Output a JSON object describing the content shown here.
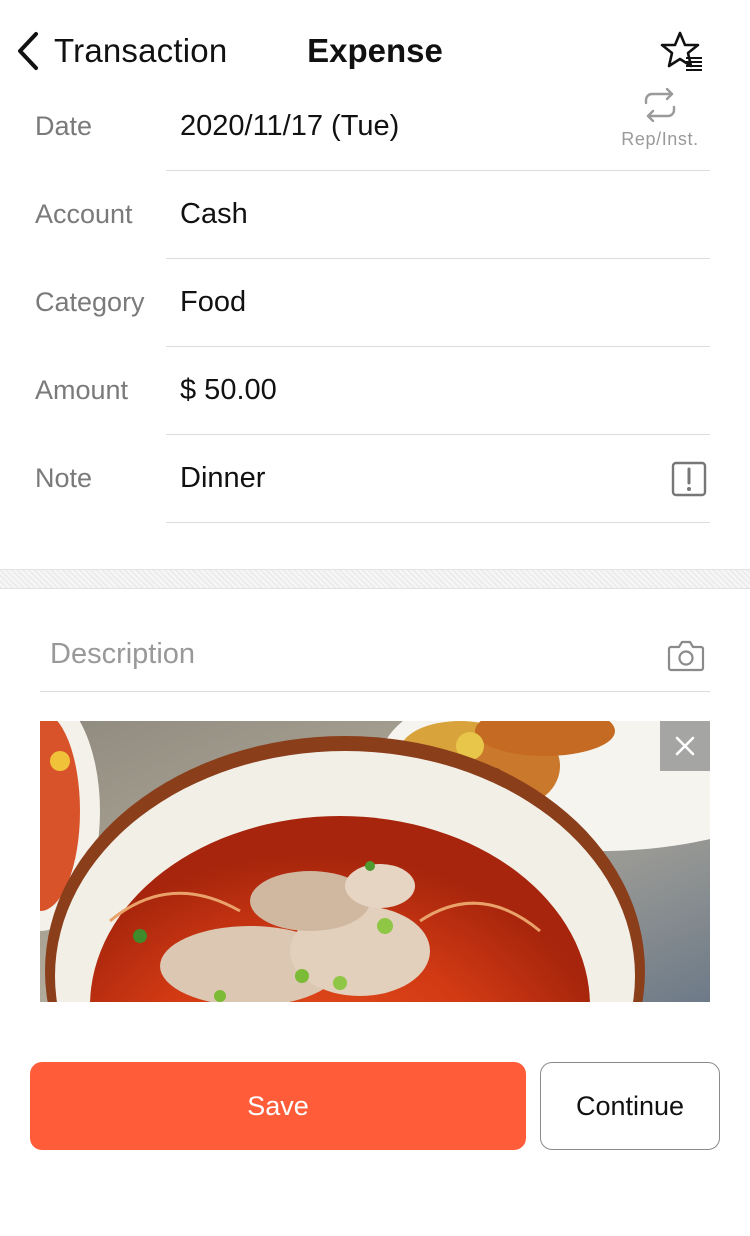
{
  "header": {
    "back_label": "Transaction",
    "title": "Expense",
    "icons": {
      "back": "chevron-left-icon",
      "favorite": "star-list-icon"
    }
  },
  "form": {
    "rows": [
      {
        "label": "Date",
        "value": "2020/11/17 (Tue)"
      },
      {
        "label": "Account",
        "value": "Cash"
      },
      {
        "label": "Category",
        "value": "Food"
      },
      {
        "label": "Amount",
        "value": "$ 50.00"
      },
      {
        "label": "Note",
        "value": "Dinner"
      }
    ],
    "repeat_caption": "Rep/Inst.",
    "icons": {
      "repeat": "repeat-icon",
      "note": "alert-square-icon"
    }
  },
  "description": {
    "placeholder": "Description",
    "icons": {
      "camera": "camera-icon"
    }
  },
  "attachment": {
    "alt": "food photo",
    "icons": {
      "remove": "close-icon"
    }
  },
  "actions": {
    "save_label": "Save",
    "continue_label": "Continue"
  },
  "colors": {
    "accent": "#ff5c3a",
    "label_gray": "#7a7a7a",
    "divider": "#dcdcdc"
  }
}
